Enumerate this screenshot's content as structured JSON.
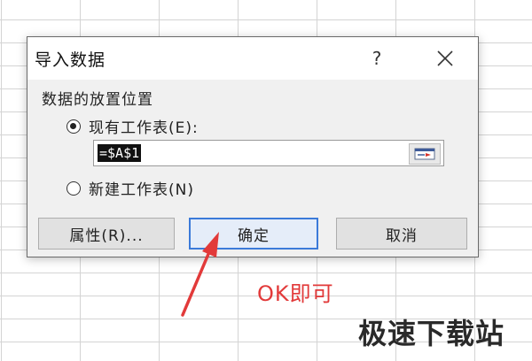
{
  "dialog": {
    "title": "导入数据",
    "help_label": "?",
    "group_label": "数据的放置位置",
    "option_existing": "现有工作表(E):",
    "option_new": "新建工作表(N)",
    "ref_value": "=$A$1",
    "properties_button": "属性(R)...",
    "ok_button": "确定",
    "cancel_button": "取消",
    "selected_option": "existing"
  },
  "annotation": {
    "text": "OK即可",
    "color": "#e23a3a"
  },
  "watermark": {
    "text": "极速下载站"
  },
  "icons": {
    "close": "close-icon",
    "collapse": "range-collapse-icon"
  }
}
